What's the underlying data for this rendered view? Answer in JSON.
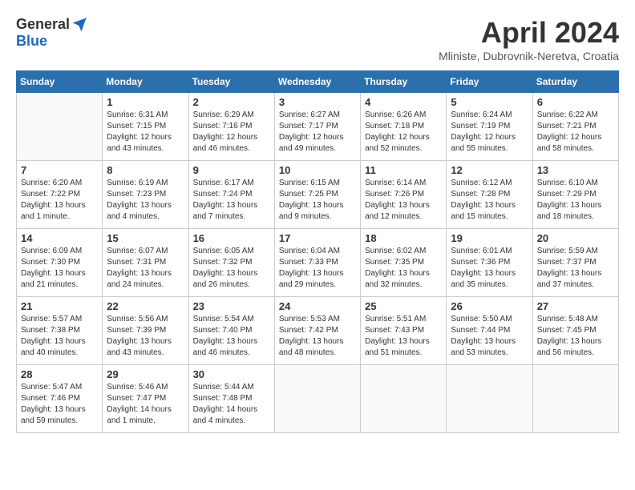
{
  "header": {
    "logo_general": "General",
    "logo_blue": "Blue",
    "month_title": "April 2024",
    "location": "Mliniste, Dubrovnik-Neretva, Croatia"
  },
  "weekdays": [
    "Sunday",
    "Monday",
    "Tuesday",
    "Wednesday",
    "Thursday",
    "Friday",
    "Saturday"
  ],
  "weeks": [
    [
      {
        "day": "",
        "sunrise": "",
        "sunset": "",
        "daylight": ""
      },
      {
        "day": "1",
        "sunrise": "Sunrise: 6:31 AM",
        "sunset": "Sunset: 7:15 PM",
        "daylight": "Daylight: 12 hours and 43 minutes."
      },
      {
        "day": "2",
        "sunrise": "Sunrise: 6:29 AM",
        "sunset": "Sunset: 7:16 PM",
        "daylight": "Daylight: 12 hours and 46 minutes."
      },
      {
        "day": "3",
        "sunrise": "Sunrise: 6:27 AM",
        "sunset": "Sunset: 7:17 PM",
        "daylight": "Daylight: 12 hours and 49 minutes."
      },
      {
        "day": "4",
        "sunrise": "Sunrise: 6:26 AM",
        "sunset": "Sunset: 7:18 PM",
        "daylight": "Daylight: 12 hours and 52 minutes."
      },
      {
        "day": "5",
        "sunrise": "Sunrise: 6:24 AM",
        "sunset": "Sunset: 7:19 PM",
        "daylight": "Daylight: 12 hours and 55 minutes."
      },
      {
        "day": "6",
        "sunrise": "Sunrise: 6:22 AM",
        "sunset": "Sunset: 7:21 PM",
        "daylight": "Daylight: 12 hours and 58 minutes."
      }
    ],
    [
      {
        "day": "7",
        "sunrise": "Sunrise: 6:20 AM",
        "sunset": "Sunset: 7:22 PM",
        "daylight": "Daylight: 13 hours and 1 minute."
      },
      {
        "day": "8",
        "sunrise": "Sunrise: 6:19 AM",
        "sunset": "Sunset: 7:23 PM",
        "daylight": "Daylight: 13 hours and 4 minutes."
      },
      {
        "day": "9",
        "sunrise": "Sunrise: 6:17 AM",
        "sunset": "Sunset: 7:24 PM",
        "daylight": "Daylight: 13 hours and 7 minutes."
      },
      {
        "day": "10",
        "sunrise": "Sunrise: 6:15 AM",
        "sunset": "Sunset: 7:25 PM",
        "daylight": "Daylight: 13 hours and 9 minutes."
      },
      {
        "day": "11",
        "sunrise": "Sunrise: 6:14 AM",
        "sunset": "Sunset: 7:26 PM",
        "daylight": "Daylight: 13 hours and 12 minutes."
      },
      {
        "day": "12",
        "sunrise": "Sunrise: 6:12 AM",
        "sunset": "Sunset: 7:28 PM",
        "daylight": "Daylight: 13 hours and 15 minutes."
      },
      {
        "day": "13",
        "sunrise": "Sunrise: 6:10 AM",
        "sunset": "Sunset: 7:29 PM",
        "daylight": "Daylight: 13 hours and 18 minutes."
      }
    ],
    [
      {
        "day": "14",
        "sunrise": "Sunrise: 6:09 AM",
        "sunset": "Sunset: 7:30 PM",
        "daylight": "Daylight: 13 hours and 21 minutes."
      },
      {
        "day": "15",
        "sunrise": "Sunrise: 6:07 AM",
        "sunset": "Sunset: 7:31 PM",
        "daylight": "Daylight: 13 hours and 24 minutes."
      },
      {
        "day": "16",
        "sunrise": "Sunrise: 6:05 AM",
        "sunset": "Sunset: 7:32 PM",
        "daylight": "Daylight: 13 hours and 26 minutes."
      },
      {
        "day": "17",
        "sunrise": "Sunrise: 6:04 AM",
        "sunset": "Sunset: 7:33 PM",
        "daylight": "Daylight: 13 hours and 29 minutes."
      },
      {
        "day": "18",
        "sunrise": "Sunrise: 6:02 AM",
        "sunset": "Sunset: 7:35 PM",
        "daylight": "Daylight: 13 hours and 32 minutes."
      },
      {
        "day": "19",
        "sunrise": "Sunrise: 6:01 AM",
        "sunset": "Sunset: 7:36 PM",
        "daylight": "Daylight: 13 hours and 35 minutes."
      },
      {
        "day": "20",
        "sunrise": "Sunrise: 5:59 AM",
        "sunset": "Sunset: 7:37 PM",
        "daylight": "Daylight: 13 hours and 37 minutes."
      }
    ],
    [
      {
        "day": "21",
        "sunrise": "Sunrise: 5:57 AM",
        "sunset": "Sunset: 7:38 PM",
        "daylight": "Daylight: 13 hours and 40 minutes."
      },
      {
        "day": "22",
        "sunrise": "Sunrise: 5:56 AM",
        "sunset": "Sunset: 7:39 PM",
        "daylight": "Daylight: 13 hours and 43 minutes."
      },
      {
        "day": "23",
        "sunrise": "Sunrise: 5:54 AM",
        "sunset": "Sunset: 7:40 PM",
        "daylight": "Daylight: 13 hours and 46 minutes."
      },
      {
        "day": "24",
        "sunrise": "Sunrise: 5:53 AM",
        "sunset": "Sunset: 7:42 PM",
        "daylight": "Daylight: 13 hours and 48 minutes."
      },
      {
        "day": "25",
        "sunrise": "Sunrise: 5:51 AM",
        "sunset": "Sunset: 7:43 PM",
        "daylight": "Daylight: 13 hours and 51 minutes."
      },
      {
        "day": "26",
        "sunrise": "Sunrise: 5:50 AM",
        "sunset": "Sunset: 7:44 PM",
        "daylight": "Daylight: 13 hours and 53 minutes."
      },
      {
        "day": "27",
        "sunrise": "Sunrise: 5:48 AM",
        "sunset": "Sunset: 7:45 PM",
        "daylight": "Daylight: 13 hours and 56 minutes."
      }
    ],
    [
      {
        "day": "28",
        "sunrise": "Sunrise: 5:47 AM",
        "sunset": "Sunset: 7:46 PM",
        "daylight": "Daylight: 13 hours and 59 minutes."
      },
      {
        "day": "29",
        "sunrise": "Sunrise: 5:46 AM",
        "sunset": "Sunset: 7:47 PM",
        "daylight": "Daylight: 14 hours and 1 minute."
      },
      {
        "day": "30",
        "sunrise": "Sunrise: 5:44 AM",
        "sunset": "Sunset: 7:48 PM",
        "daylight": "Daylight: 14 hours and 4 minutes."
      },
      {
        "day": "",
        "sunrise": "",
        "sunset": "",
        "daylight": ""
      },
      {
        "day": "",
        "sunrise": "",
        "sunset": "",
        "daylight": ""
      },
      {
        "day": "",
        "sunrise": "",
        "sunset": "",
        "daylight": ""
      },
      {
        "day": "",
        "sunrise": "",
        "sunset": "",
        "daylight": ""
      }
    ]
  ]
}
